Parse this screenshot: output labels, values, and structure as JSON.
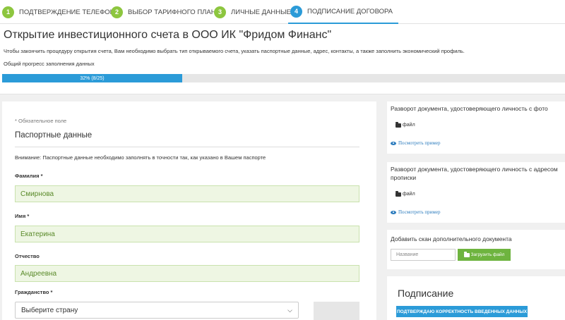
{
  "stepper": {
    "steps": [
      {
        "num": "1",
        "label": "ПОДТВЕРЖДЕНИЕ ТЕЛЕФОНА",
        "state": "done"
      },
      {
        "num": "2",
        "label": "ВЫБОР ТАРИФНОГО ПЛАНА",
        "state": "done"
      },
      {
        "num": "3",
        "label": "ЛИЧНЫЕ ДАННЫЕ",
        "state": "done"
      },
      {
        "num": "4",
        "label": "ПОДПИСАНИЕ ДОГОВОРА",
        "state": "active"
      }
    ]
  },
  "header": {
    "title": "Открытие инвестиционного счета в ООО ИК \"Фридом Финанс\"",
    "description": "Чтобы закончить процедуру открытия счета, Вам необходимо выбрать тип открываемого счета, указать паспортные данные, адрес, контакты, а также заполнить экономический профиль.",
    "progress_label": "Общий прогресс заполнения данных",
    "progress_text": "32% (8/25)",
    "progress_fraction": 0.32
  },
  "form": {
    "required_note": "* Обязательное поле",
    "section_title": "Паспортные данные",
    "warning": "Внимание: Паспортные данные необходимо заполнять в точности так, как указано в Вашем паспорте",
    "last_name_label": "Фамилия *",
    "last_name_value": "Смирнова",
    "first_name_label": "Имя *",
    "first_name_value": "Екатерина",
    "patronymic_label": "Отчество",
    "patronymic_value": "Андреевна",
    "citizenship_label": "Гражданство *",
    "citizenship_value": "Выберите страну"
  },
  "documents": {
    "photo_page": {
      "title": "Разворот документа, удостоверяющего личность с фото",
      "file_label": "файл",
      "example_link": "Посмотреть пример"
    },
    "address_page": {
      "title": "Разворот документа, удостоверяющего личность с адресом прописки",
      "file_label": "файл",
      "example_link": "Посмотреть пример"
    },
    "add_scan": {
      "title": "Добавить скан дополнительного документа",
      "name_placeholder": "Название",
      "upload_label": "Загрузить файл"
    }
  },
  "signing": {
    "title": "Подписание",
    "confirm_label": "ПОДТВЕРЖДАЮ КОРРЕКТНОСТЬ ВВЕДЕННЫХ ДАННЫХ"
  },
  "colors": {
    "accent_blue": "#2b9bd8",
    "done_green": "#8dc63f",
    "upload_green": "#6eb43f",
    "filled_field_bg": "#eef6e3",
    "filled_field_text": "#5a8a2a",
    "link_blue": "#2b7bbd"
  },
  "icons": [
    "folder-icon",
    "eye-icon",
    "chevron-down-icon"
  ]
}
